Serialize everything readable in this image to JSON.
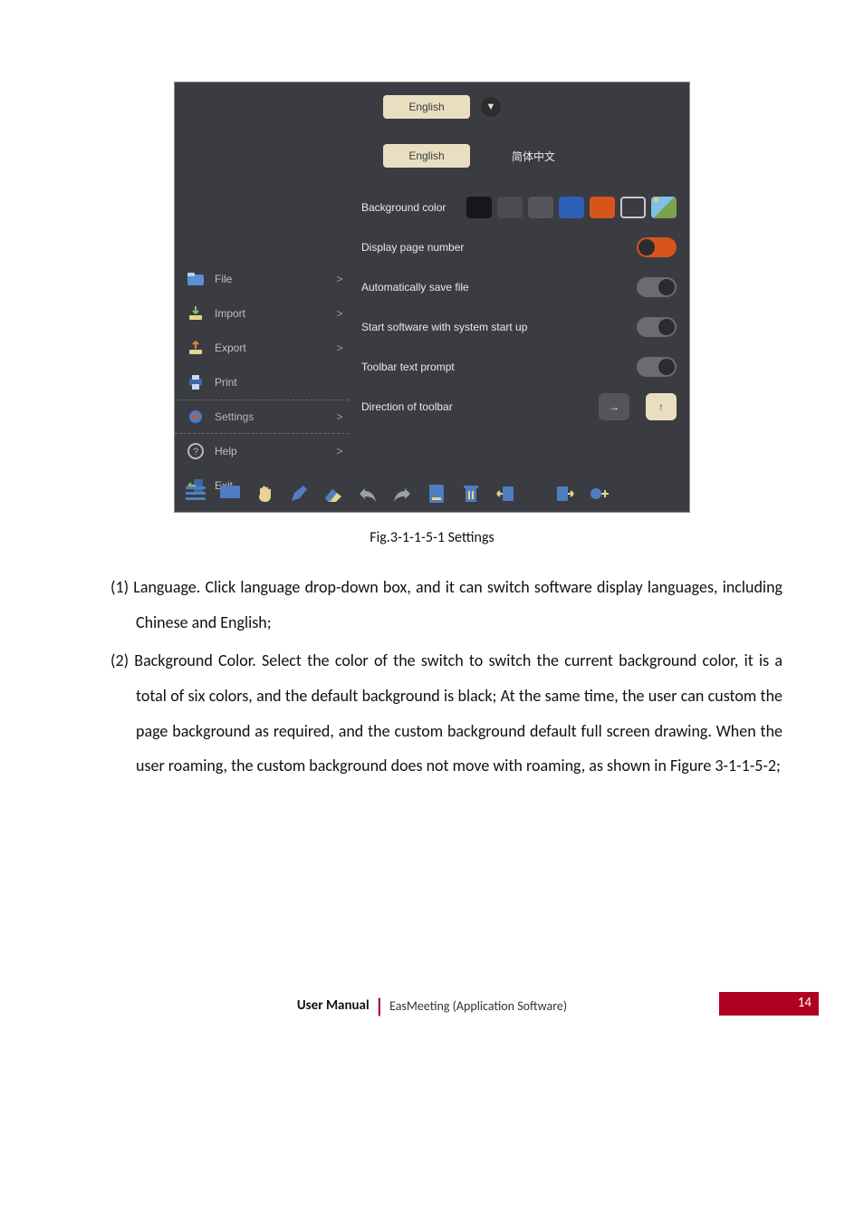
{
  "app": {
    "language_dropdown_selected": "English",
    "language_tabs": {
      "english": "English",
      "chinese": "简体中文"
    },
    "labels": {
      "background_color": "Background color",
      "display_page_number": "Display page number",
      "auto_save": "Automatically save file",
      "start_with_system": "Start software with system start up",
      "toolbar_text_prompt": "Toolbar text prompt",
      "direction_of_toolbar": "Direction of toolbar"
    },
    "bg_swatch_colors": [
      "#17171a",
      "#4a4a52",
      "#55555d",
      "#2d5fb8",
      "#d7551a"
    ],
    "bg_swatch_outline": "2px solid #c7c7cc",
    "toggles": {
      "display_page_number": "on",
      "auto_save": "off",
      "start_with_system": "off",
      "toolbar_text_prompt": "off"
    },
    "direction_arrows": {
      "right": "→",
      "up": "↑"
    },
    "sidebar": {
      "file": {
        "label": "File",
        "chev": ">"
      },
      "import": {
        "label": "Import",
        "chev": ">"
      },
      "export": {
        "label": "Export",
        "chev": ">"
      },
      "print": {
        "label": "Print",
        "chev": ""
      },
      "settings": {
        "label": "Settings",
        "chev": ">"
      },
      "help": {
        "label": "Help",
        "chev": ">"
      },
      "exit": {
        "label": "Exit",
        "chev": ""
      }
    }
  },
  "caption": "Fig.3-1-1-5-1 Settings",
  "body": {
    "p1": "(1) Language. Click language drop-down box, and it can switch software display languages, including Chinese and English;",
    "p2": "(2) Background Color. Select the color of the switch to switch the current background color, it is a total of six colors, and the default background is black; At the same time, the user can custom the page background as required, and the custom background default full screen drawing. When the user roaming, the custom background does not move with roaming, as shown in Figure 3-1-1-5-2;"
  },
  "footer": {
    "user_manual": "User Manual",
    "app_name": "EasMeeting (Application Software)",
    "page_number": "14"
  }
}
